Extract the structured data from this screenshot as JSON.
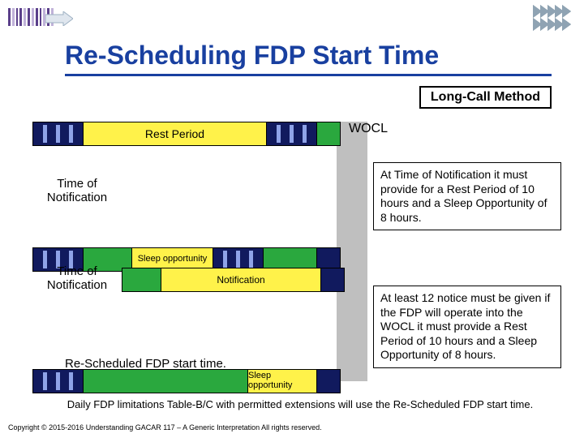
{
  "title": "Re-Scheduling FDP Start Time",
  "method_label": "Long-Call Method",
  "wocl_label": "WOCL",
  "bars": {
    "rest_period": "Rest Period",
    "sleep_opportunity": "Sleep opportunity",
    "notification": "Notification"
  },
  "labels": {
    "time_of_notification": "Time of\nNotification",
    "re_scheduled_start": "Re-Scheduled FDP start time."
  },
  "text_boxes": {
    "box1": "At Time of Notification it must provide for a Rest Period of 10 hours and a Sleep Opportunity of 8 hours.",
    "box2": "At least 12 notice must be given if the FDP will operate into the WOCL it must provide a Rest Period of 10 hours and a Sleep Opportunity of 8 hours."
  },
  "footnote": "Daily FDP limitations Table-B/C with permitted extensions will use the Re-Scheduled FDP start time.",
  "copyright": "Copyright © 2015-2016 Understanding GACAR 117 – A Generic Interpretation All rights reserved."
}
